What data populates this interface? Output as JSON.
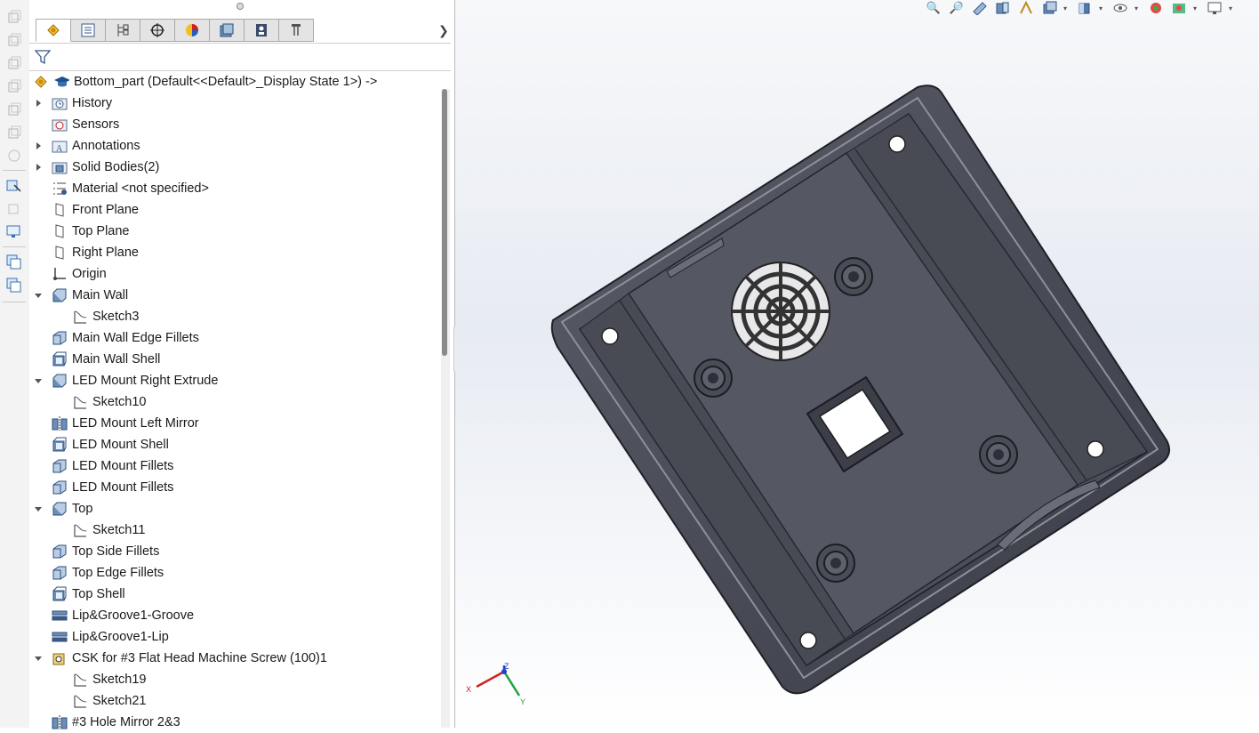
{
  "feature_tree": {
    "root": "Bottom_part  (Default<<Default>_Display State 1>) ->",
    "items": [
      {
        "label": "History",
        "icon": "history-folder-icon",
        "level": 0,
        "expander": "collapsed"
      },
      {
        "label": "Sensors",
        "icon": "sensors-folder-icon",
        "level": 0,
        "expander": "none"
      },
      {
        "label": "Annotations",
        "icon": "annotations-folder-icon",
        "level": 0,
        "expander": "collapsed"
      },
      {
        "label": "Solid Bodies(2)",
        "icon": "solid-bodies-folder-icon",
        "level": 0,
        "expander": "collapsed"
      },
      {
        "label": "Material <not specified>",
        "icon": "material-icon",
        "level": 0,
        "expander": "none"
      },
      {
        "label": "Front Plane",
        "icon": "plane-icon",
        "level": 0,
        "expander": "none"
      },
      {
        "label": "Top Plane",
        "icon": "plane-icon",
        "level": 0,
        "expander": "none"
      },
      {
        "label": "Right Plane",
        "icon": "plane-icon",
        "level": 0,
        "expander": "none"
      },
      {
        "label": "Origin",
        "icon": "origin-icon",
        "level": 0,
        "expander": "none"
      },
      {
        "label": "Main Wall",
        "icon": "extrude-icon",
        "level": 0,
        "expander": "expanded"
      },
      {
        "label": "Sketch3",
        "icon": "sketch-icon",
        "level": 1,
        "expander": "none"
      },
      {
        "label": "Main Wall Edge Fillets",
        "icon": "fillet-icon",
        "level": 0,
        "expander": "none"
      },
      {
        "label": "Main Wall Shell",
        "icon": "shell-icon",
        "level": 0,
        "expander": "none"
      },
      {
        "label": "LED Mount Right Extrude",
        "icon": "extrude-icon",
        "level": 0,
        "expander": "expanded"
      },
      {
        "label": "Sketch10",
        "icon": "sketch-icon",
        "level": 1,
        "expander": "none"
      },
      {
        "label": "LED Mount Left Mirror",
        "icon": "mirror-icon",
        "level": 0,
        "expander": "none"
      },
      {
        "label": "LED Mount Shell",
        "icon": "shell-icon",
        "level": 0,
        "expander": "none"
      },
      {
        "label": "LED Mount Fillets",
        "icon": "fillet-icon",
        "level": 0,
        "expander": "none"
      },
      {
        "label": "LED Mount Fillets",
        "icon": "fillet-icon",
        "level": 0,
        "expander": "none"
      },
      {
        "label": "Top",
        "icon": "extrude-icon",
        "level": 0,
        "expander": "expanded"
      },
      {
        "label": "Sketch11",
        "icon": "sketch-icon",
        "level": 1,
        "expander": "none"
      },
      {
        "label": "Top Side Fillets",
        "icon": "fillet-icon",
        "level": 0,
        "expander": "none"
      },
      {
        "label": "Top Edge Fillets",
        "icon": "fillet-icon",
        "level": 0,
        "expander": "none"
      },
      {
        "label": "Top Shell",
        "icon": "shell-icon",
        "level": 0,
        "expander": "none"
      },
      {
        "label": "Lip&Groove1-Groove",
        "icon": "lip-groove-icon",
        "level": 0,
        "expander": "none"
      },
      {
        "label": "Lip&Groove1-Lip",
        "icon": "lip-groove-icon",
        "level": 0,
        "expander": "none"
      },
      {
        "label": "CSK for #3 Flat Head Machine Screw (100)1",
        "icon": "hole-wizard-icon",
        "level": 0,
        "expander": "expanded"
      },
      {
        "label": "Sketch19",
        "icon": "sketch-icon",
        "level": 1,
        "expander": "none"
      },
      {
        "label": "Sketch21",
        "icon": "sketch-icon",
        "level": 1,
        "expander": "none"
      },
      {
        "label": "#3 Hole Mirror 2&3",
        "icon": "mirror-icon",
        "level": 0,
        "expander": "none"
      }
    ]
  },
  "panel_tabs": [
    {
      "icon": "feature-manager-tab-icon"
    },
    {
      "icon": "property-manager-tab-icon"
    },
    {
      "icon": "configuration-manager-tab-icon"
    },
    {
      "icon": "dimxpert-manager-tab-icon"
    },
    {
      "icon": "display-manager-tab-icon"
    },
    {
      "icon": "cam-feature-tab-icon"
    },
    {
      "icon": "cam-operation-tab-icon"
    },
    {
      "icon": "cam-toolpath-tab-icon"
    }
  ],
  "triad": {
    "x": "X",
    "y": "Y",
    "z": "Z"
  },
  "colors": {
    "panel_bg": "#ffffff",
    "model_body": "#4e505c",
    "model_dark": "#2e3038",
    "accent_blue": "#3a6fb0"
  }
}
